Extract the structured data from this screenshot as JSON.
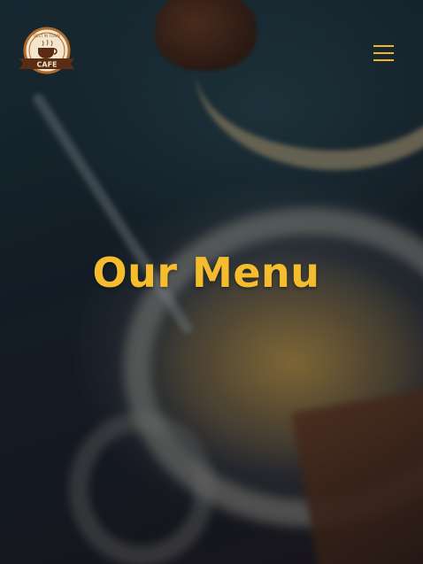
{
  "brand": {
    "logo_top_text": "BEST IN TOWN",
    "logo_label": "CAFE",
    "colors": {
      "accent": "#f5bd2d",
      "logo_ring": "#b06a2a",
      "logo_banner": "#5a2c14"
    }
  },
  "nav": {
    "toggle_icon": "hamburger-menu-icon"
  },
  "hero": {
    "title": "Our Menu"
  }
}
